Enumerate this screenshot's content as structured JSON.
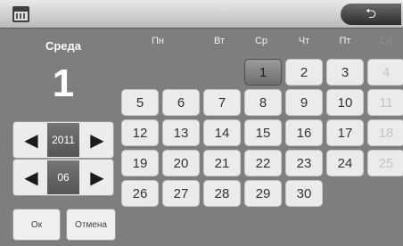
{
  "back_icon": "return-arrow",
  "selected": {
    "day_name": "Среда",
    "day": "1"
  },
  "year": {
    "value": "2011"
  },
  "month": {
    "value": "06"
  },
  "buttons": {
    "ok": "Ок",
    "cancel": "Отмена"
  },
  "weekdays": [
    "Пн",
    "Вт",
    "Ср",
    "Чт",
    "Пт",
    "Сб"
  ],
  "calendar": {
    "rows": [
      [
        "",
        "",
        "",
        "1",
        "2",
        "3",
        "4"
      ],
      [
        "5",
        "6",
        "7",
        "8",
        "9",
        "10",
        "11"
      ],
      [
        "12",
        "13",
        "14",
        "15",
        "16",
        "17",
        "18"
      ],
      [
        "19",
        "20",
        "21",
        "22",
        "23",
        "24",
        "25"
      ],
      [
        "26",
        "27",
        "28",
        "29",
        "30",
        "",
        ""
      ]
    ],
    "selected_day": "1",
    "disabled_days": [
      "4",
      "11",
      "18",
      "25"
    ]
  }
}
